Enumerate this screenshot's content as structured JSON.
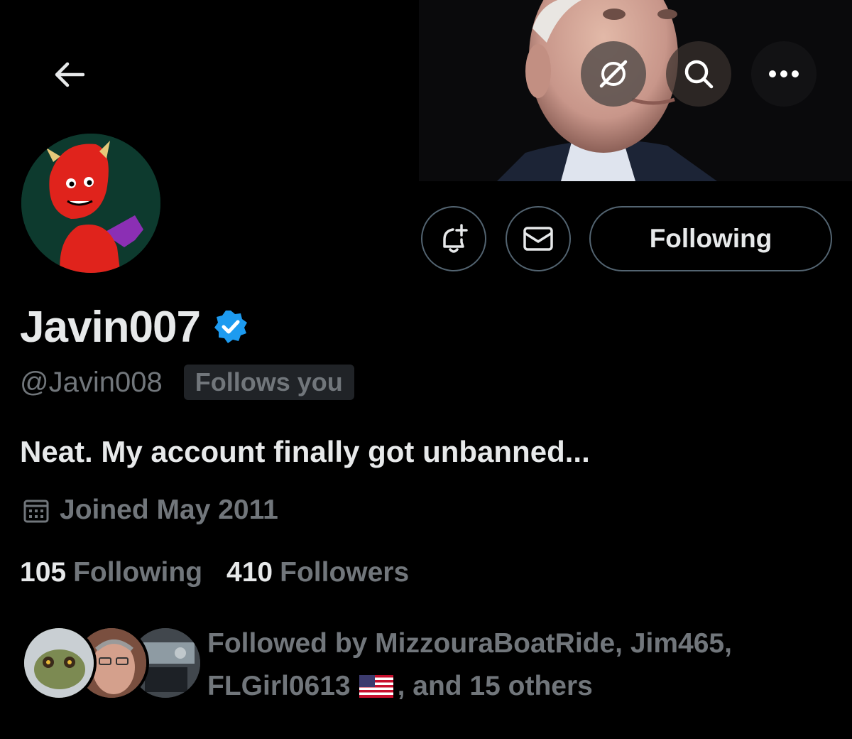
{
  "header": {
    "back_icon": "arrow-left-icon",
    "grok_icon": "grok-icon",
    "search_icon": "search-icon",
    "more_icon": "more-horizontal-icon"
  },
  "profile": {
    "display_name": "Javin007",
    "verified": true,
    "handle": "@Javin008",
    "follows_you_badge": "Follows you",
    "bio": "Neat. My account finally got unbanned...",
    "joined": "Joined May 2011",
    "following_count": "105",
    "following_label": "Following",
    "followers_count": "410",
    "followers_label": "Followers"
  },
  "actions": {
    "notify_icon": "bell-plus-icon",
    "message_icon": "envelope-icon",
    "following_button_label": "Following"
  },
  "followed_by": {
    "line1": "Followed by MizzouraBoatRide, Jim465,",
    "line2_user": "FLGirl0613",
    "line2_rest": ", and 15 others"
  },
  "colors": {
    "background": "#000000",
    "text_primary": "#e7e9ea",
    "text_secondary": "#71767b",
    "border": "#536471",
    "verified_blue": "#1d9bf0"
  }
}
